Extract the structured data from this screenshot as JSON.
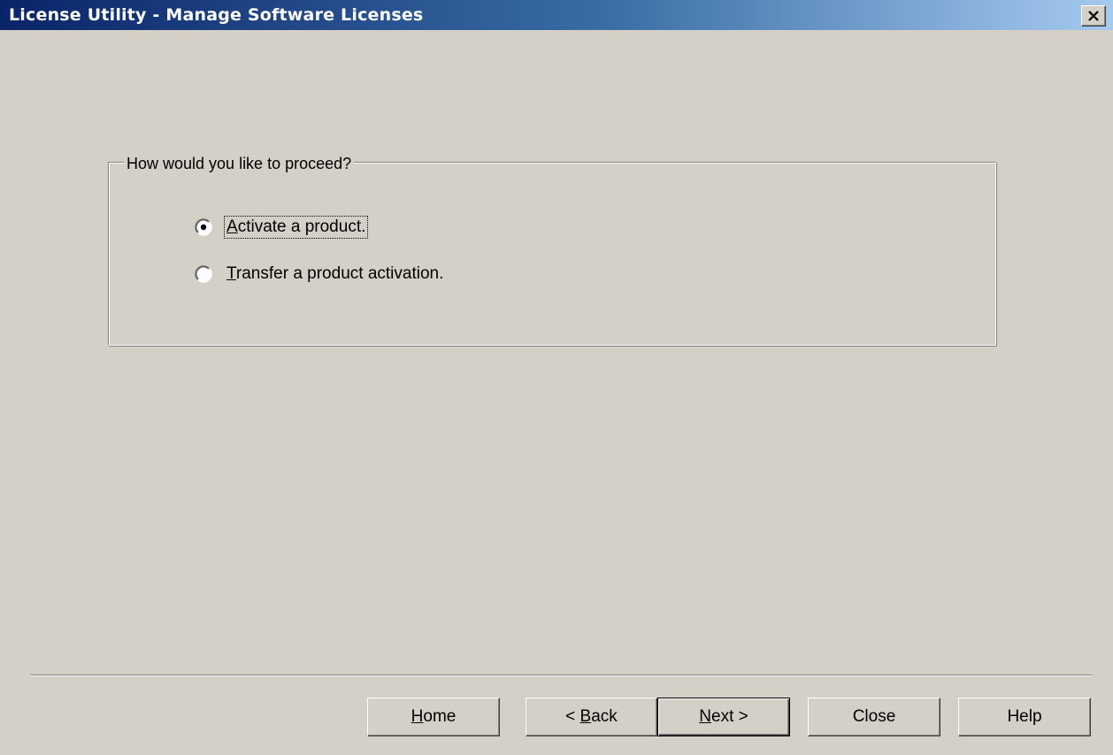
{
  "window": {
    "title": "License Utility - Manage Software Licenses",
    "close_symbol": "✕"
  },
  "group": {
    "legend": "How would you like to proceed?",
    "options": [
      {
        "mnemonic": "A",
        "rest": "ctivate a product.",
        "checked": true
      },
      {
        "mnemonic": "T",
        "rest": "ransfer a product activation.",
        "checked": false
      }
    ]
  },
  "buttons": {
    "home": {
      "pre": "",
      "mnemonic": "H",
      "post": "ome"
    },
    "back": {
      "pre": "< ",
      "mnemonic": "B",
      "post": "ack"
    },
    "next": {
      "pre": "",
      "mnemonic": "N",
      "post": "ext >"
    },
    "close": {
      "label": "Close"
    },
    "help": {
      "label": "Help"
    }
  },
  "icons": {
    "close": "close-icon",
    "radio_checked": "radio-checked-icon",
    "radio_unchecked": "radio-unchecked-icon"
  },
  "colors": {
    "titlebar_start": "#0a246a",
    "titlebar_end": "#a6caf0",
    "face": "#d4d0c8"
  }
}
